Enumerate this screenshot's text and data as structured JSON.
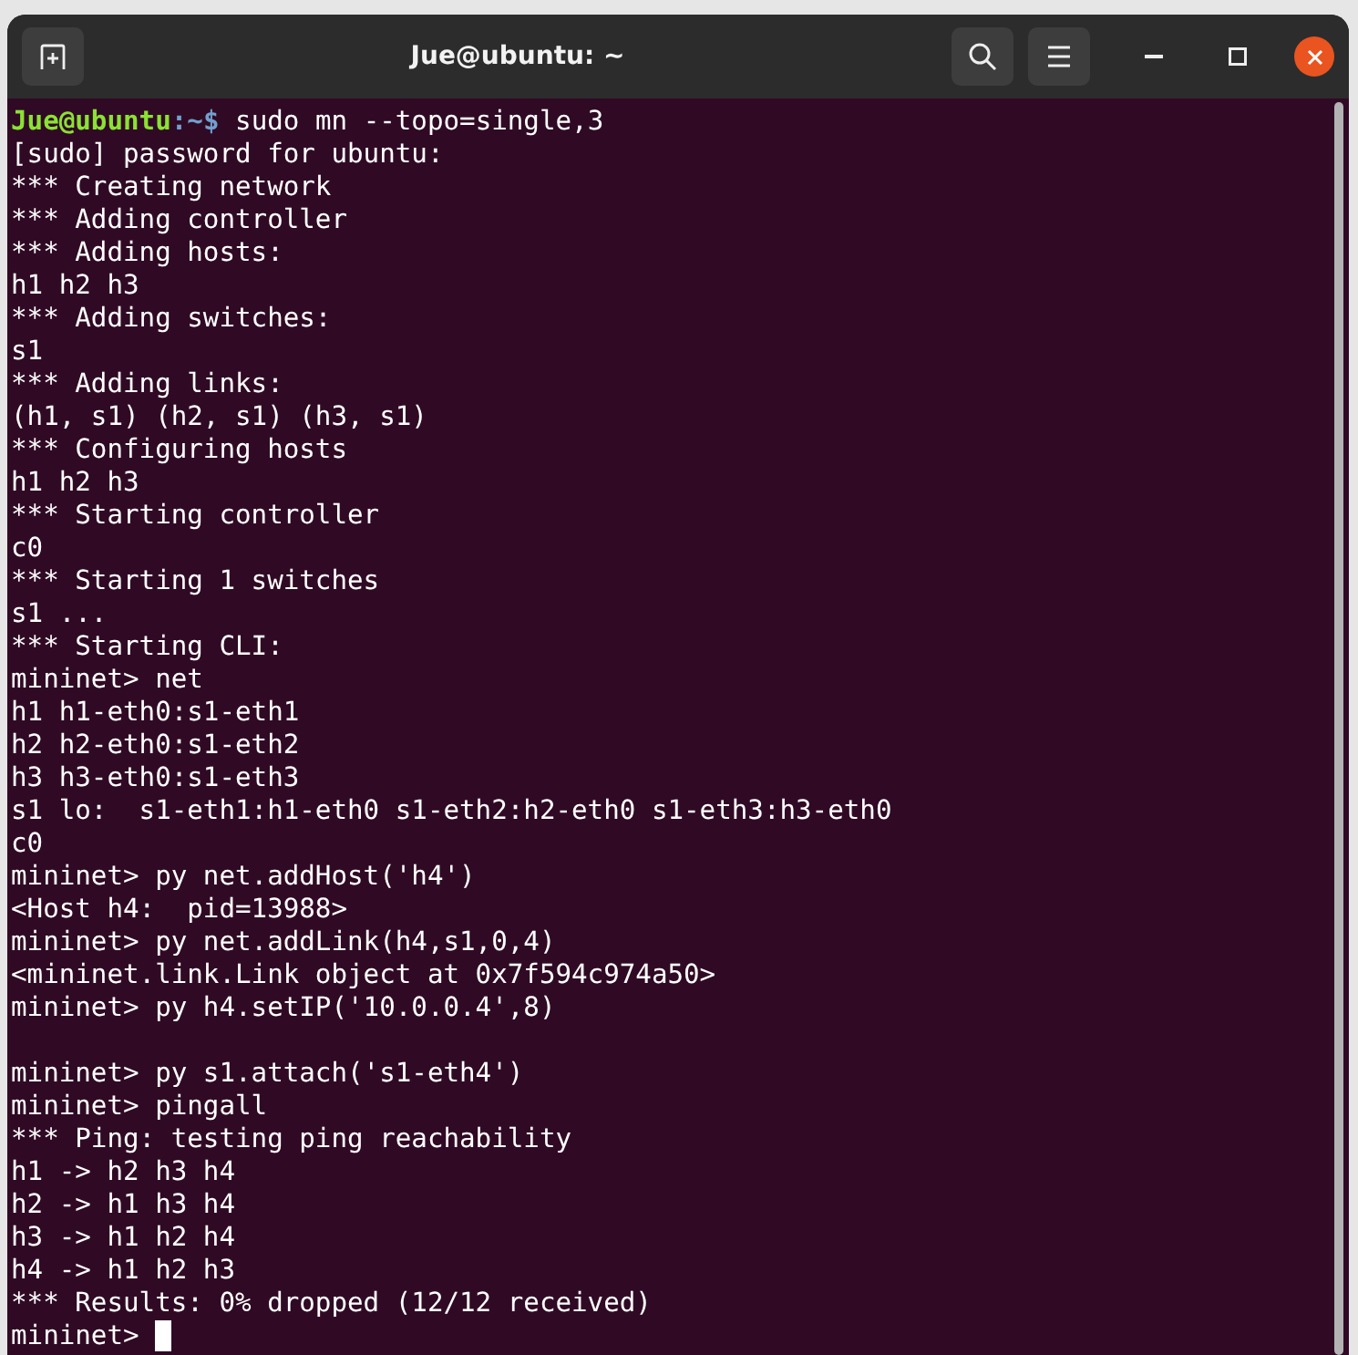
{
  "window": {
    "title": "Jue@ubuntu: ~"
  },
  "terminal": {
    "lines": [
      {
        "kind": "prompt",
        "user_host": "Jue@ubuntu",
        "path": ":~$",
        "command": "sudo mn --topo=single,3"
      },
      {
        "kind": "output",
        "text": "[sudo] password for ubuntu:"
      },
      {
        "kind": "output",
        "text": "*** Creating network"
      },
      {
        "kind": "output",
        "text": "*** Adding controller"
      },
      {
        "kind": "output",
        "text": "*** Adding hosts:"
      },
      {
        "kind": "output",
        "text": "h1 h2 h3"
      },
      {
        "kind": "output",
        "text": "*** Adding switches:"
      },
      {
        "kind": "output",
        "text": "s1"
      },
      {
        "kind": "output",
        "text": "*** Adding links:"
      },
      {
        "kind": "output",
        "text": "(h1, s1) (h2, s1) (h3, s1)"
      },
      {
        "kind": "output",
        "text": "*** Configuring hosts"
      },
      {
        "kind": "output",
        "text": "h1 h2 h3"
      },
      {
        "kind": "output",
        "text": "*** Starting controller"
      },
      {
        "kind": "output",
        "text": "c0"
      },
      {
        "kind": "output",
        "text": "*** Starting 1 switches"
      },
      {
        "kind": "output",
        "text": "s1 ..."
      },
      {
        "kind": "output",
        "text": "*** Starting CLI:"
      },
      {
        "kind": "output",
        "text": "mininet> net"
      },
      {
        "kind": "output",
        "text": "h1 h1-eth0:s1-eth1"
      },
      {
        "kind": "output",
        "text": "h2 h2-eth0:s1-eth2"
      },
      {
        "kind": "output",
        "text": "h3 h3-eth0:s1-eth3"
      },
      {
        "kind": "output",
        "text": "s1 lo:  s1-eth1:h1-eth0 s1-eth2:h2-eth0 s1-eth3:h3-eth0"
      },
      {
        "kind": "output",
        "text": "c0"
      },
      {
        "kind": "output",
        "text": "mininet> py net.addHost('h4')"
      },
      {
        "kind": "output",
        "text": "<Host h4:  pid=13988>"
      },
      {
        "kind": "output",
        "text": "mininet> py net.addLink(h4,s1,0,4)"
      },
      {
        "kind": "output",
        "text": "<mininet.link.Link object at 0x7f594c974a50>"
      },
      {
        "kind": "output",
        "text": "mininet> py h4.setIP('10.0.0.4',8)"
      },
      {
        "kind": "blank"
      },
      {
        "kind": "output",
        "text": "mininet> py s1.attach('s1-eth4')"
      },
      {
        "kind": "output",
        "text": "mininet> pingall"
      },
      {
        "kind": "output",
        "text": "*** Ping: testing ping reachability"
      },
      {
        "kind": "output",
        "text": "h1 -> h2 h3 h4"
      },
      {
        "kind": "output",
        "text": "h2 -> h1 h3 h4"
      },
      {
        "kind": "output",
        "text": "h3 -> h1 h2 h4"
      },
      {
        "kind": "output",
        "text": "h4 -> h1 h2 h3"
      },
      {
        "kind": "output",
        "text": "*** Results: 0% dropped (12/12 received)"
      },
      {
        "kind": "input",
        "text": "mininet>"
      }
    ]
  }
}
